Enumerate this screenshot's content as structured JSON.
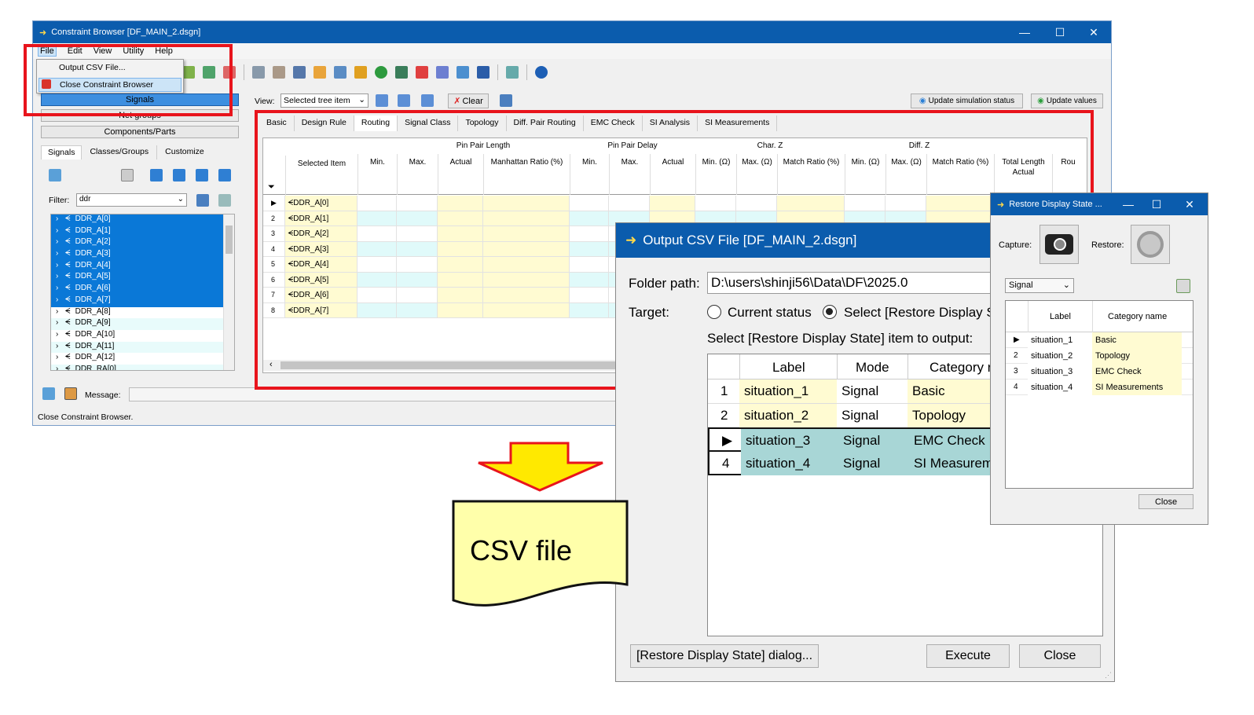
{
  "main": {
    "title": "Constraint Browser [DF_MAIN_2.dsgn]",
    "menu": [
      "File",
      "Edit",
      "View",
      "Utility",
      "Help"
    ],
    "file_menu": [
      "Output CSV File...",
      "Close Constraint Browser"
    ],
    "left_buttons": [
      "Signals",
      "Net groups",
      "Components/Parts"
    ],
    "left_tabs": [
      "Signals",
      "Classes/Groups",
      "Customize"
    ],
    "filter_label": "Filter:",
    "filter_value": "ddr",
    "tree_items": [
      "DDR_A[0]",
      "DDR_A[1]",
      "DDR_A[2]",
      "DDR_A[3]",
      "DDR_A[4]",
      "DDR_A[5]",
      "DDR_A[6]",
      "DDR_A[7]",
      "DDR_A[8]",
      "DDR_A[9]",
      "DDR_A[10]",
      "DDR_A[11]",
      "DDR_A[12]",
      "DDR_RA[0]"
    ],
    "view_label": "View:",
    "view_value": "Selected tree item",
    "clear_label": "Clear",
    "update_sim": "Update simulation status",
    "update_values": "Update values",
    "grid_tabs": [
      "Basic",
      "Design Rule",
      "Routing",
      "Signal Class",
      "Topology",
      "Diff. Pair Routing",
      "EMC Check",
      "SI Analysis",
      "SI Measurements"
    ],
    "group_headers": [
      "Pin Pair Length",
      "Pin Pair Delay",
      "Char. Z",
      "Diff. Z"
    ],
    "sub_headers": [
      "Selected Item",
      "Min.",
      "Max.",
      "Actual",
      "Manhattan Ratio (%)",
      "Min.",
      "Max.",
      "Actual",
      "Min. (Ω)",
      "Max. (Ω)",
      "Match Ratio (%)",
      "Min. (Ω)",
      "Max. (Ω)",
      "Match Ratio (%)",
      "Total Length Actual",
      "Rou"
    ],
    "grid_rows": [
      "DDR_A[0]",
      "DDR_A[1]",
      "DDR_A[2]",
      "DDR_A[3]",
      "DDR_A[4]",
      "DDR_A[5]",
      "DDR_A[6]",
      "DDR_A[7]"
    ],
    "row_numbers": [
      "2",
      "3",
      "4",
      "5",
      "6",
      "7",
      "8"
    ],
    "message_label": "Message:",
    "status": "Close Constraint Browser."
  },
  "csv_dialog": {
    "title": "Output CSV File [DF_MAIN_2.dsgn]",
    "folder_label": "Folder path:",
    "folder_value": "D:\\users\\shinji56\\Data\\DF\\2025.0",
    "target_label": "Target:",
    "radio_current": "Current status",
    "radio_select": "Select [Restore Display St",
    "select_prompt": "Select [Restore Display State] item to output:",
    "headers": [
      "Label",
      "Mode",
      "Category r"
    ],
    "rows": [
      {
        "num": "1",
        "label": "situation_1",
        "mode": "Signal",
        "category": "Basic"
      },
      {
        "num": "2",
        "label": "situation_2",
        "mode": "Signal",
        "category": "Topology"
      },
      {
        "num": "",
        "label": "situation_3",
        "mode": "Signal",
        "category": "EMC Check"
      },
      {
        "num": "4",
        "label": "situation_4",
        "mode": "Signal",
        "category": "SI Measurem"
      }
    ],
    "restore_button": "[Restore Display State] dialog...",
    "execute": "Execute",
    "close": "Close"
  },
  "restore_dialog": {
    "title": "Restore Display State ...",
    "capture_label": "Capture:",
    "restore_label": "Restore:",
    "mode_value": "Signal",
    "headers": [
      "Label",
      "Category name"
    ],
    "rows": [
      {
        "num": "",
        "label": "situation_1",
        "category": "Basic"
      },
      {
        "num": "2",
        "label": "situation_2",
        "category": "Topology"
      },
      {
        "num": "3",
        "label": "situation_3",
        "category": "EMC Check"
      },
      {
        "num": "4",
        "label": "situation_4",
        "category": "SI Measurements"
      }
    ],
    "close": "Close"
  },
  "callout": {
    "text": "CSV file"
  },
  "colors": {
    "title": "#0b5cad",
    "highlight": "#e8141c",
    "select": "#0a78d7",
    "cell_yellow": "#fffbd2",
    "cell_cyan": "#e0fafa",
    "arrow": "#ffe900"
  }
}
